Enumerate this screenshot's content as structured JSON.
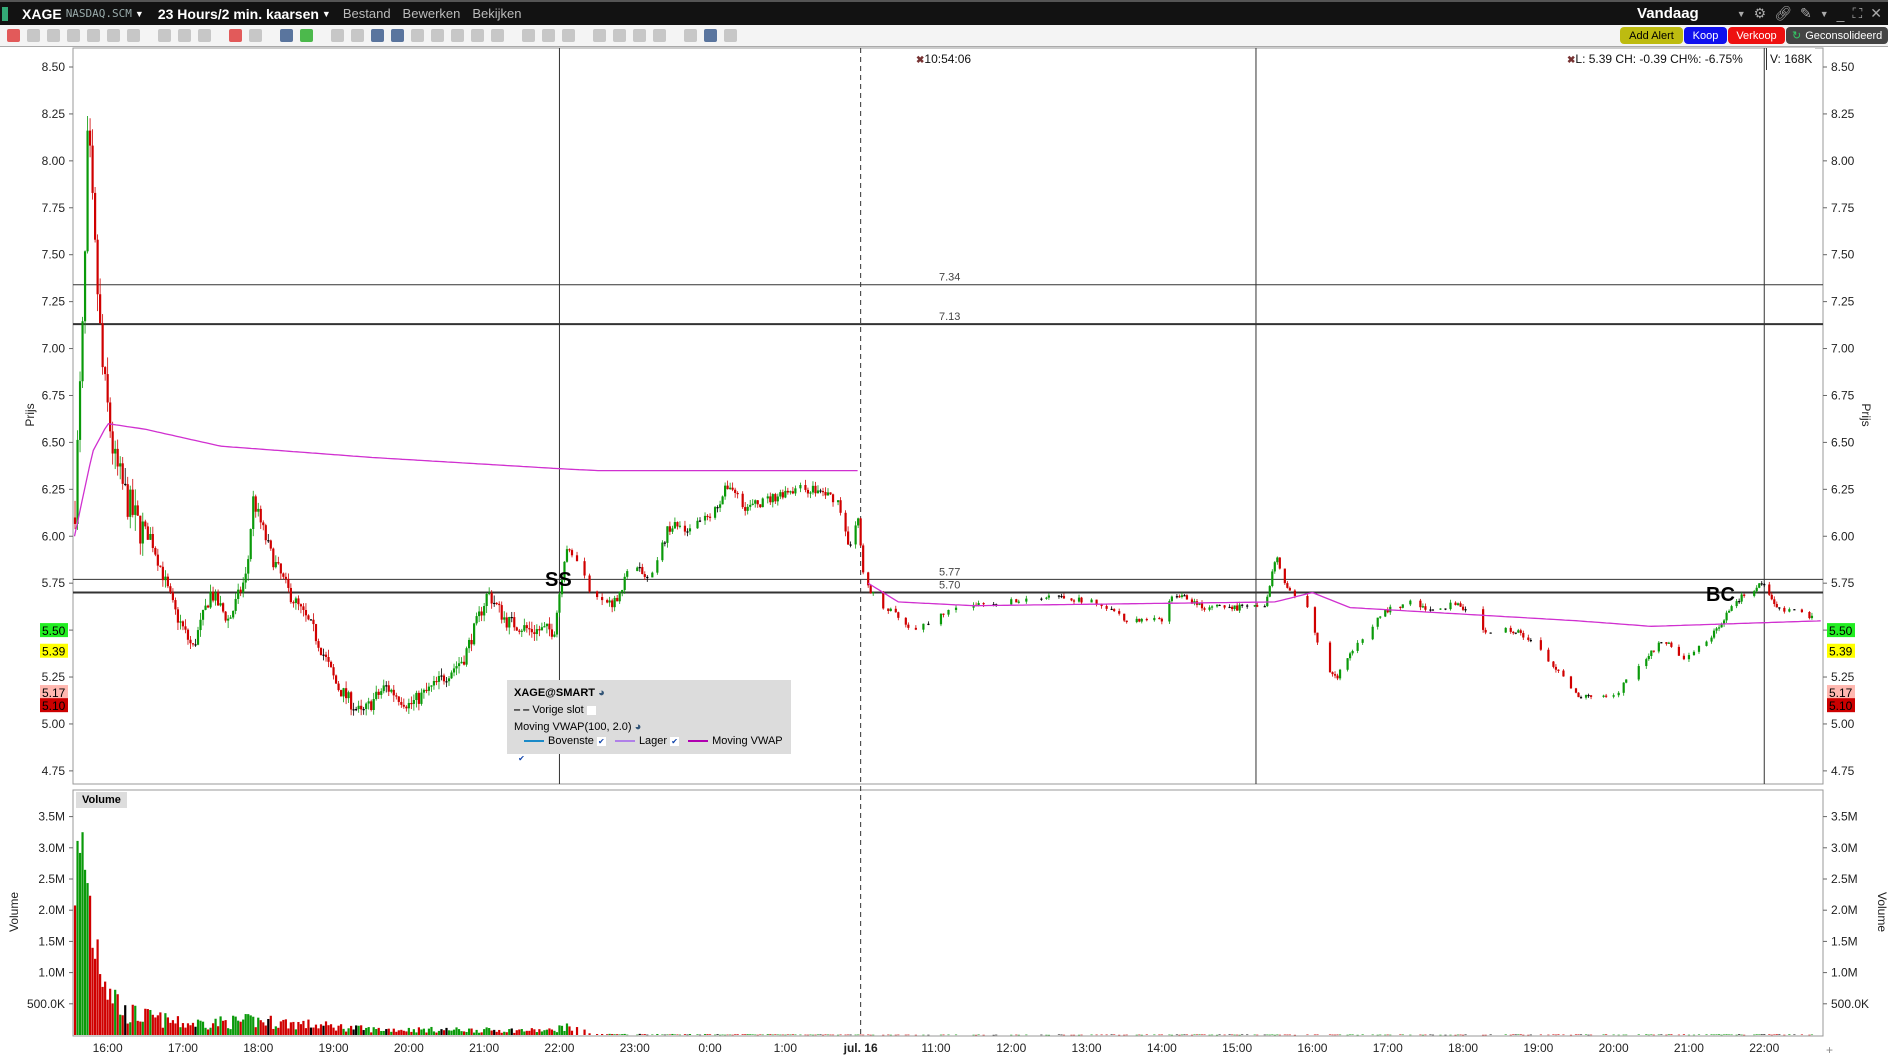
{
  "header": {
    "symbol": "XAGE",
    "exchange": "NASDAQ.SCM",
    "period": "23 Hours/2 min. kaarsen",
    "menus": [
      "Bestand",
      "Bewerken",
      "Bekijken"
    ],
    "range": "Vandaag"
  },
  "actions": {
    "add_alert": "Add Alert",
    "buy": "Koop",
    "sell": "Verkoop",
    "data_mode": "Geconsolideerd"
  },
  "readout": {
    "time": "10:54:06",
    "quote": "L: 5.39 CH: -0.39 CH%: -6.75%",
    "volume": "V: 168K"
  },
  "legend": {
    "title": "XAGE@SMART",
    "prev_close": "Vorige slot",
    "indicator": "Moving VWAP(100, 2.0)",
    "bands": [
      "Bovenste",
      "Lager",
      "Moving VWAP"
    ],
    "band_colors": [
      "#1a8ac8",
      "#b080e8",
      "#b000b0"
    ]
  },
  "annotations": [
    "SS",
    "BC"
  ],
  "volume_pane_title": "Volume",
  "chart_data": {
    "type": "candlestick",
    "x_unit": "hours since 15:30 (session slots)",
    "xticks": [
      {
        "h": 0.5,
        "label": "16:00"
      },
      {
        "h": 1.5,
        "label": "17:00"
      },
      {
        "h": 2.5,
        "label": "18:00"
      },
      {
        "h": 3.5,
        "label": "19:00"
      },
      {
        "h": 4.5,
        "label": "20:00"
      },
      {
        "h": 5.5,
        "label": "21:00"
      },
      {
        "h": 6.5,
        "label": "22:00"
      },
      {
        "h": 7.5,
        "label": "23:00"
      },
      {
        "h": 8.5,
        "label": "0:00"
      },
      {
        "h": 9.5,
        "label": "1:00"
      },
      {
        "h": 10.5,
        "label": "jul. 16",
        "bold": true
      },
      {
        "h": 11.5,
        "label": "11:00"
      },
      {
        "h": 12.5,
        "label": "12:00"
      },
      {
        "h": 13.5,
        "label": "13:00"
      },
      {
        "h": 14.5,
        "label": "14:00"
      },
      {
        "h": 15.5,
        "label": "15:00"
      },
      {
        "h": 16.5,
        "label": "16:00"
      },
      {
        "h": 17.5,
        "label": "17:00"
      },
      {
        "h": 18.5,
        "label": "18:00"
      },
      {
        "h": 19.5,
        "label": "19:00"
      },
      {
        "h": 20.5,
        "label": "20:00"
      },
      {
        "h": 21.5,
        "label": "21:00"
      },
      {
        "h": 22.5,
        "label": "22:00"
      }
    ],
    "price_axis": {
      "label": "Prijs",
      "ylim": [
        4.75,
        8.5
      ],
      "ticks": [
        "8.50",
        "8.25",
        "8.00",
        "7.75",
        "7.50",
        "7.25",
        "7.00",
        "6.75",
        "6.50",
        "6.25",
        "6.00",
        "5.75",
        "5.50",
        "5.25",
        "5.00",
        "4.75"
      ]
    },
    "price_badges": [
      {
        "value": "5.50",
        "color": "#22ee22"
      },
      {
        "value": "5.39",
        "color": "#ffff00"
      },
      {
        "value": "5.17",
        "color": "#ffb8b0"
      },
      {
        "value": "5.10",
        "color": "#cc0000"
      }
    ],
    "hlines": [
      {
        "value": 7.34,
        "label": "7.34"
      },
      {
        "value": 7.13,
        "label": "7.13"
      },
      {
        "value": 5.77,
        "label": "5.77"
      },
      {
        "value": 5.7,
        "label": "5.70"
      }
    ],
    "price_path": [
      [
        0.06,
        6.1
      ],
      [
        0.19,
        7.3
      ],
      [
        0.24,
        8.2
      ],
      [
        0.32,
        7.6
      ],
      [
        0.43,
        6.9
      ],
      [
        0.59,
        6.4
      ],
      [
        0.75,
        6.2
      ],
      [
        0.91,
        6.05
      ],
      [
        1.07,
        6.0
      ],
      [
        1.23,
        5.8
      ],
      [
        1.39,
        5.6
      ],
      [
        1.63,
        5.4
      ],
      [
        1.87,
        5.7
      ],
      [
        2.11,
        5.55
      ],
      [
        2.35,
        5.8
      ],
      [
        2.43,
        6.2
      ],
      [
        2.67,
        5.9
      ],
      [
        2.91,
        5.7
      ],
      [
        3.23,
        5.5
      ],
      [
        3.55,
        5.2
      ],
      [
        3.87,
        5.05
      ],
      [
        4.19,
        5.2
      ],
      [
        4.51,
        5.1
      ],
      [
        4.83,
        5.2
      ],
      [
        5.23,
        5.35
      ],
      [
        5.55,
        5.7
      ],
      [
        5.79,
        5.55
      ],
      [
        6.11,
        5.5
      ],
      [
        6.43,
        5.5
      ],
      [
        6.59,
        5.95
      ],
      [
        6.75,
        5.85
      ],
      [
        6.99,
        5.65
      ],
      [
        7.23,
        5.65
      ],
      [
        7.47,
        5.85
      ],
      [
        7.71,
        5.75
      ],
      [
        7.95,
        6.05
      ],
      [
        8.27,
        6.05
      ],
      [
        8.51,
        6.1
      ],
      [
        8.75,
        6.28
      ],
      [
        8.99,
        6.15
      ],
      [
        9.31,
        6.2
      ],
      [
        9.55,
        6.25
      ],
      [
        9.87,
        6.25
      ],
      [
        10.19,
        6.2
      ],
      [
        10.35,
        5.95
      ],
      [
        10.46,
        6.1
      ],
      [
        10.55,
        5.75
      ],
      [
        10.74,
        5.65
      ],
      [
        11.22,
        5.5
      ],
      [
        11.7,
        5.6
      ],
      [
        12.34,
        5.65
      ],
      [
        12.98,
        5.68
      ],
      [
        13.62,
        5.65
      ],
      [
        14.02,
        5.55
      ],
      [
        14.5,
        5.55
      ],
      [
        14.66,
        5.7
      ],
      [
        15.06,
        5.62
      ],
      [
        15.54,
        5.62
      ],
      [
        15.86,
        5.62
      ],
      [
        16.02,
        5.9
      ],
      [
        16.18,
        5.7
      ],
      [
        16.42,
        5.65
      ],
      [
        16.66,
        5.3
      ],
      [
        16.82,
        5.25
      ],
      [
        17.14,
        5.45
      ],
      [
        17.46,
        5.6
      ],
      [
        17.78,
        5.65
      ],
      [
        18.1,
        5.6
      ],
      [
        18.42,
        5.65
      ],
      [
        18.74,
        5.5
      ],
      [
        19.22,
        5.5
      ],
      [
        19.62,
        5.35
      ],
      [
        20.02,
        5.15
      ],
      [
        20.5,
        5.15
      ],
      [
        20.82,
        5.3
      ],
      [
        21.14,
        5.45
      ],
      [
        21.46,
        5.35
      ],
      [
        21.78,
        5.45
      ],
      [
        22.1,
        5.65
      ],
      [
        22.5,
        5.75
      ],
      [
        22.66,
        5.62
      ],
      [
        23.06,
        5.58
      ]
    ],
    "vwap": [
      [
        [
          0.06,
          6.0
        ],
        [
          0.3,
          6.45
        ],
        [
          0.5,
          6.6
        ],
        [
          1,
          6.57
        ],
        [
          2,
          6.48
        ],
        [
          4,
          6.42
        ],
        [
          6.5,
          6.36
        ],
        [
          7,
          6.35
        ],
        [
          10.5,
          6.35
        ]
      ],
      [
        [
          10.6,
          5.75
        ],
        [
          11,
          5.65
        ],
        [
          12,
          5.63
        ],
        [
          16,
          5.65
        ],
        [
          16.5,
          5.7
        ],
        [
          17,
          5.62
        ],
        [
          20,
          5.55
        ],
        [
          21,
          5.52
        ],
        [
          23.3,
          5.55
        ]
      ]
    ],
    "volume_axis": {
      "label": "Volume",
      "ticks": [
        {
          "v": 3500000,
          "label": "3.5M"
        },
        {
          "v": 3000000,
          "label": "3.0M"
        },
        {
          "v": 2500000,
          "label": "2.5M"
        },
        {
          "v": 2000000,
          "label": "2.0M"
        },
        {
          "v": 1500000,
          "label": "1.5M"
        },
        {
          "v": 1000000,
          "label": "1.0M"
        },
        {
          "v": 500000,
          "label": "500.0K"
        }
      ]
    },
    "volume_path": [
      [
        0,
        2000000
      ],
      [
        0.05,
        3750000
      ],
      [
        0.1,
        2700000
      ],
      [
        0.2,
        3050000
      ],
      [
        0.3,
        1900000
      ],
      [
        0.5,
        1000000
      ],
      [
        0.7,
        400000
      ],
      [
        1.5,
        200000
      ],
      [
        2.5,
        250000
      ],
      [
        4,
        100000
      ],
      [
        6.4,
        80000
      ],
      [
        6.55,
        150000
      ],
      [
        7,
        15000
      ],
      [
        10.5,
        5000
      ],
      [
        23.3,
        8000
      ]
    ],
    "session_lines_h": [
      6.5,
      15.75,
      22.5
    ],
    "day_separator_h": 10.5
  }
}
